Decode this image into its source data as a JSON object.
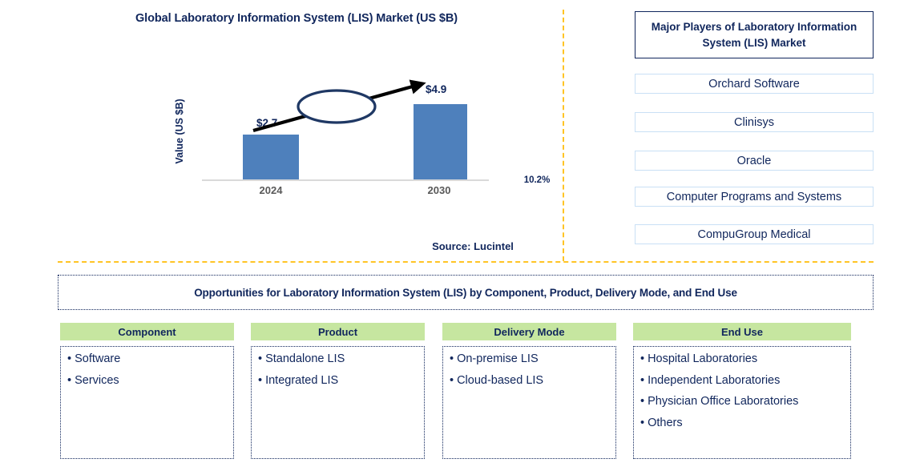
{
  "chart_panel": {
    "title": "Global Laboratory Information System (LIS) Market (US $B)",
    "source": "Source: Lucintel"
  },
  "chart_data": {
    "type": "bar",
    "title": "Global Laboratory Information System (LIS) Market (US $B)",
    "categories": [
      "2024",
      "2030"
    ],
    "values": [
      2.7,
      4.9
    ],
    "data_labels": [
      "$2.7",
      "$4.9"
    ],
    "xlabel": "",
    "ylabel": "Value (US $B)",
    "ylim": [
      0,
      5.6
    ],
    "grid": false,
    "legend": "none",
    "annotations": [
      {
        "text": "10.2%",
        "kind": "cagr-callout",
        "shape": "ellipse"
      }
    ],
    "bar_color": "#4e80bc",
    "accent_color": "#10265c",
    "divider_color": "#ffc425",
    "header_green": "#c6e6a0",
    "source": "Source: Lucintel"
  },
  "players_panel": {
    "header": "Major Players of Laboratory Information System (LIS) Market",
    "items": [
      {
        "label": "Orchard Software"
      },
      {
        "label": "Clinisys"
      },
      {
        "label": "Oracle"
      },
      {
        "label": "Computer Programs and Systems"
      },
      {
        "label": "CompuGroup Medical"
      }
    ]
  },
  "opportunities": {
    "banner": "Opportunities for Laboratory Information System (LIS) by Component, Product, Delivery Mode, and End Use",
    "columns": [
      {
        "header": "Component",
        "items": [
          "Software",
          "Services"
        ]
      },
      {
        "header": "Product",
        "items": [
          "Standalone LIS",
          "Integrated LIS"
        ]
      },
      {
        "header": "Delivery Mode",
        "items": [
          "On-premise LIS",
          "Cloud-based LIS"
        ]
      },
      {
        "header": "End Use",
        "items": [
          "Hospital Laboratories",
          "Independent Laboratories",
          "Physician Office Laboratories",
          "Others"
        ]
      }
    ]
  },
  "icons": {
    "bullet": "•",
    "growth_arrow": "growth-arrow-icon",
    "cagr_ellipse": "cagr-ellipse-icon"
  }
}
